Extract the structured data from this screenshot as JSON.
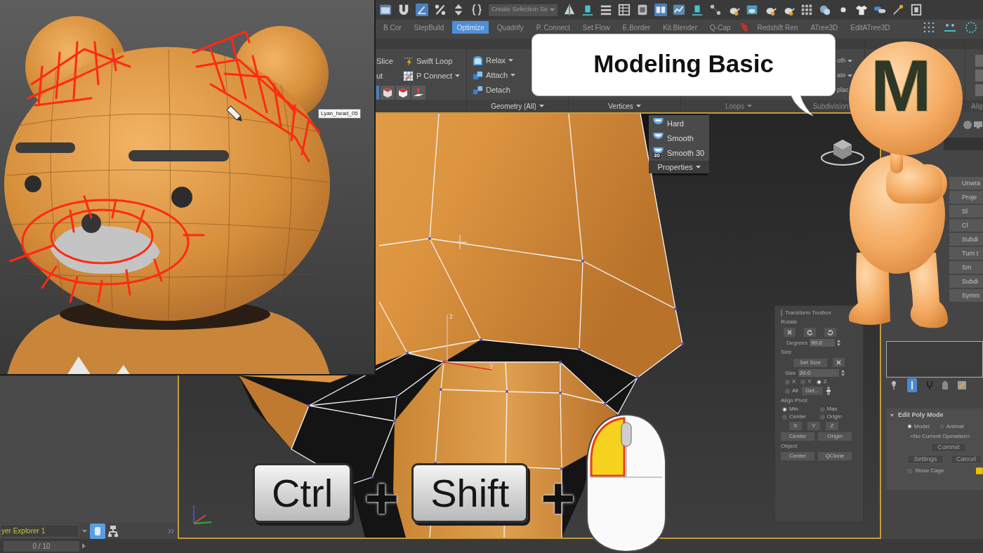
{
  "toolbar": {
    "selection_set": "Create Selection Se"
  },
  "ribbon_tabs": [
    {
      "label": "B.Cor",
      "selected": false
    },
    {
      "label": "StepBuild",
      "selected": false
    },
    {
      "label": "Optimize",
      "selected": true
    },
    {
      "label": "Quadrify",
      "selected": false
    },
    {
      "label": "P. Connect",
      "selected": false
    },
    {
      "label": "Set Flow",
      "selected": false
    },
    {
      "label": "E.Border",
      "selected": false
    },
    {
      "label": "Kit.Blender",
      "selected": false
    },
    {
      "label": "Q-Cap",
      "selected": false
    },
    {
      "label": "Redshift Ren",
      "selected": false
    },
    {
      "label": "ATree3D",
      "selected": false
    },
    {
      "label": "EditATree3D",
      "selected": false
    }
  ],
  "ribbon_tools": [
    {
      "label": "Slice",
      "dropdown": false
    },
    {
      "label": "ut",
      "dropdown": false
    },
    {
      "label": "Swift Loop",
      "dropdown": false
    },
    {
      "label": "P Connect",
      "dropdown": true
    },
    {
      "label": "Relax",
      "dropdown": true
    },
    {
      "label": "Attach",
      "dropdown": true
    },
    {
      "label": "Detach",
      "dropdown": false
    }
  ],
  "ribbon_partial": [
    {
      "label": "oth",
      "dropdown": true
    },
    {
      "label": "ate",
      "dropdown": true
    },
    {
      "label": "plac",
      "dropdown": false
    }
  ],
  "ribbon_panels": [
    {
      "label": "Geometry (All)",
      "dropdown": true,
      "disabled": false
    },
    {
      "label": "Vertices",
      "dropdown": true,
      "disabled": false
    },
    {
      "label": "Loops",
      "dropdown": true,
      "disabled": true
    },
    {
      "label": "Subdivision",
      "dropdown": false,
      "disabled": true
    },
    {
      "label": "Alig",
      "dropdown": false,
      "disabled": true
    }
  ],
  "properties_menu": {
    "items": [
      {
        "label": "Hard"
      },
      {
        "label": "Smooth"
      },
      {
        "label": "Smooth 30",
        "icon_text": "30"
      }
    ],
    "title": "Properties"
  },
  "inset": {
    "tooltip": "Lyan_head_05"
  },
  "speech_bubble": {
    "text": "Modeling Basic"
  },
  "mascot": {
    "letter": "M"
  },
  "viewport": {
    "axis_labels": [
      "z",
      "y"
    ]
  },
  "shortcut": [
    {
      "kind": "key",
      "label": "Ctrl"
    },
    {
      "kind": "plus",
      "label": "+"
    },
    {
      "kind": "key",
      "label": "Shift"
    },
    {
      "kind": "plus",
      "label": "+"
    },
    {
      "kind": "mouse",
      "left_pressed": true
    }
  ],
  "transform_toolbox": {
    "title": "Transform Toolbox",
    "rotate": {
      "title": "Rotate",
      "degrees_label": "Degrees",
      "degrees": "90.0"
    },
    "size": {
      "title": "Size",
      "button": "Set Size",
      "size_label": "Size",
      "size": "20.0",
      "axes": [
        {
          "label": "X",
          "selected": false
        },
        {
          "label": "Y",
          "selected": false
        },
        {
          "label": "Z",
          "selected": true
        }
      ],
      "all": {
        "label": "All",
        "selected": false
      },
      "get": "Get..."
    },
    "align_pivot": {
      "title": "Align Pivot",
      "options": [
        {
          "label": "Min",
          "selected": true
        },
        {
          "label": "Max",
          "selected": false
        },
        {
          "label": "Center",
          "selected": false
        },
        {
          "label": "Origin",
          "selected": false
        }
      ],
      "axis_buttons": [
        "X",
        "Y",
        "Z"
      ],
      "buttons": [
        "Center",
        "Origin"
      ]
    },
    "object": {
      "title": "Object",
      "buttons": [
        "Center",
        "QClone"
      ]
    }
  },
  "layer_explorer": {
    "field": "yer Explorer 1",
    "counter": "0 / 10"
  },
  "command_panel": {
    "buttons": [
      "Unwra",
      "Proje",
      "Sl",
      "Cl",
      "Subdi",
      "Turn t",
      "Sm",
      "Subdi",
      "Symm"
    ],
    "rollout": {
      "title": "Edit Poly Mode",
      "modes": [
        {
          "label": "Model",
          "selected": true
        },
        {
          "label": "Animat",
          "selected": false
        }
      ],
      "operation": "<No Current Operation>",
      "actions": [
        {
          "label": "Commit",
          "disabled": true
        },
        {
          "label": "Settings",
          "disabled": true
        },
        {
          "label": "Cancel",
          "disabled": true
        }
      ],
      "show_cage": {
        "label": "Show Cage",
        "checked": false
      }
    }
  }
}
